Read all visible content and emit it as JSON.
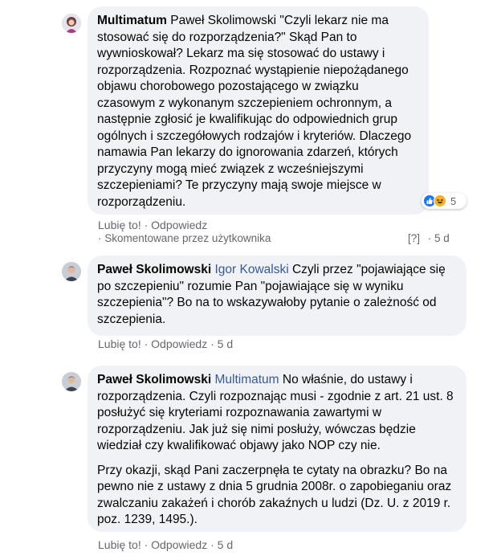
{
  "comments": [
    {
      "author": "Multimatum",
      "mention": "",
      "paragraphs": [
        "Paweł Skolimowski \"Czyli lekarz nie ma stosować się do rozporządzenia?\" Skąd Pan to wywnioskował? Lekarz ma się stosować do ustawy i rozporządzenia. Rozpoznać wystąpienie niepożądanego objawu chorobowego pozostającego w związku czasowym z wykonanym szczepieniem ochronnym, a następnie zgłosić je kwalifikując do odpowiednich grup ogólnych i szczegółowych rodzajów i kryteriów. Dlaczego namawia Pan lekarzy do ignorowania zdarzeń, których przyczyny mogą mieć związek z wcześniejszymi szczepieniami? Te przyczyny mają swoje miejsce w rozporządzeniu."
      ],
      "reaction_count": "5",
      "like_label": "Lubię to!",
      "reply_label": "Odpowiedz",
      "time": "",
      "commented_by": "· Skomentowane przez użytkownika",
      "unknown_marker": "[?]",
      "meta_time": "· 5 d"
    },
    {
      "author": "Paweł Skolimowski",
      "mention": "Igor Kowalski",
      "paragraphs": [
        "Czyli przez \"pojawiające się po szczepieniu\" rozumie Pan \"pojawiające się w wyniku szczepienia\"? Bo na to wskazywałoby pytanie o zależność od szczepienia."
      ],
      "like_label": "Lubię to!",
      "reply_label": "Odpowiedz",
      "time": "5 d"
    },
    {
      "author": "Paweł Skolimowski",
      "mention": "Multimatum",
      "paragraphs": [
        "No właśnie, do ustawy i rozporządzenia. Czyli rozpoznając musi - zgodnie z art. 21 ust. 8 posłużyć się kryteriami rozpoznawania zawartymi w rozporządzeniu. Jak już się nimi posłuży, wówczas będzie wiedział czy kwalifikować objawy jako NOP czy nie.",
        "Przy okazji, skąd Pani zaczerpnęła te cytaty na obrazku? Bo na pewno nie z ustawy z dnia 5 grudnia 2008r. o zapobieganiu oraz zwalczaniu zakażeń i chorób zakaźnych u ludzi (Dz. U. z 2019 r. poz. 1239, 1495.)."
      ],
      "like_label": "Lubię to!",
      "reply_label": "Odpowiedz",
      "time": "5 d"
    }
  ],
  "separators": {
    "dot": "·"
  },
  "colors": {
    "mention": "#385898",
    "bubble": "#f0f2f5",
    "meta": "#65676b",
    "like": "#1877f2",
    "haha": "#f7b125"
  }
}
